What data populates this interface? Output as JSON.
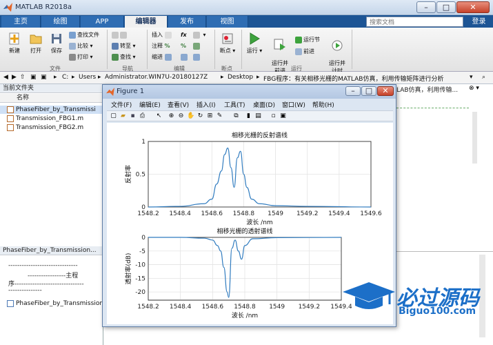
{
  "app": {
    "title": "MATLAB R2018a"
  },
  "tabs": [
    "主页",
    "绘图",
    "APP",
    "编辑器",
    "发布",
    "视图"
  ],
  "search": {
    "placeholder": "搜索文档"
  },
  "login": "登录",
  "ribbon": {
    "file": {
      "new": "新建",
      "open": "打开",
      "save": "保存",
      "find_files": "查找文件",
      "compare": "比较",
      "print": "打印",
      "group": "文件"
    },
    "navigate": {
      "goto": "转至",
      "find": "查找",
      "group": "导航"
    },
    "edit": {
      "insert": "插入",
      "comment": "注释",
      "indent": "缩进",
      "fx": "fx",
      "group": "编辑"
    },
    "breakpoints": {
      "label": "断点",
      "group": "断点"
    },
    "run": {
      "run": "运行",
      "run_advance": "运行并\n前进",
      "run_section": "运行节",
      "advance": "前进",
      "run_time": "运行并\n计时",
      "group": "运行"
    }
  },
  "path": [
    "C:",
    "Users",
    "Administrator.WIN7U-20180127Z",
    "Desktop",
    "FBG程序：有关相移光栅的MATLAB仿真，利用传输矩阵进行分析"
  ],
  "current_folder": {
    "title": "当前文件夹",
    "column": "名称",
    "files": [
      "PhaseFiber_by_Transmissi",
      "Transmission_FBG1.m",
      "Transmission_FBG2.m"
    ]
  },
  "details": {
    "title": "PhaseFiber_by_Transmission...",
    "lines": [
      "-------------------------------",
      "-----------------主程",
      "序-------------------------------",
      "---------------"
    ],
    "file": "PhaseFiber_by_Transmission"
  },
  "editor_tab_text": "LAB仿真，利用传输...",
  "figure": {
    "title": "Figure 1",
    "menu": [
      "文件(F)",
      "编辑(E)",
      "查看(V)",
      "插入(I)",
      "工具(T)",
      "桌面(D)",
      "窗口(W)",
      "帮助(H)"
    ]
  },
  "chart_data": [
    {
      "type": "line",
      "title": "相移光栅的反射谱线",
      "xlabel": "波长 /nm",
      "ylabel": "反射率",
      "xlim": [
        1548.2,
        1549.6
      ],
      "ylim": [
        0,
        1
      ],
      "xticks": [
        "1548.2",
        "1548.4",
        "1548.6",
        "1548.8",
        "1549",
        "1549.2",
        "1549.4",
        "1549.6"
      ],
      "yticks": [
        "0",
        "0.5",
        "1"
      ],
      "grid": true,
      "x": [
        1548.2,
        1548.4,
        1548.55,
        1548.6,
        1548.63,
        1548.66,
        1548.68,
        1548.7,
        1548.72,
        1548.74,
        1548.76,
        1548.78,
        1548.8,
        1548.82,
        1548.85,
        1548.9,
        1549.0,
        1549.2,
        1549.6
      ],
      "y": [
        0.0,
        0.01,
        0.05,
        0.12,
        0.35,
        0.55,
        0.8,
        0.9,
        0.6,
        0.3,
        0.75,
        0.85,
        0.5,
        0.3,
        0.12,
        0.05,
        0.02,
        0.01,
        0.0
      ],
      "color": "#2f7bbf"
    },
    {
      "type": "line",
      "title": "相移光栅的透射谱线",
      "xlabel": "波长 /nm",
      "ylabel": "透射率(dB)",
      "xlim": [
        1548.2,
        1549.4
      ],
      "ylim": [
        -23,
        0
      ],
      "xticks": [
        "1548.2",
        "1548.4",
        "1548.6",
        "1548.8",
        "1549",
        "1549.2",
        "1549.4"
      ],
      "yticks": [
        "0",
        "-5",
        "-10",
        "-15",
        "-20"
      ],
      "grid": true,
      "x": [
        1548.2,
        1548.4,
        1548.55,
        1548.6,
        1548.63,
        1548.65,
        1548.67,
        1548.69,
        1548.7,
        1548.72,
        1548.74,
        1548.76,
        1548.78,
        1548.8,
        1548.85,
        1549.0,
        1549.4
      ],
      "y": [
        0.0,
        0.0,
        -0.3,
        -1.0,
        -3.0,
        -5.0,
        -11.0,
        -20.0,
        -22.0,
        -4.0,
        -1.0,
        -5.0,
        -8.0,
        -3.0,
        -0.5,
        -0.1,
        0.0
      ],
      "color": "#2f7bbf"
    }
  ],
  "watermark": {
    "main": "必过源码",
    "sub": "Biguo100.com"
  }
}
